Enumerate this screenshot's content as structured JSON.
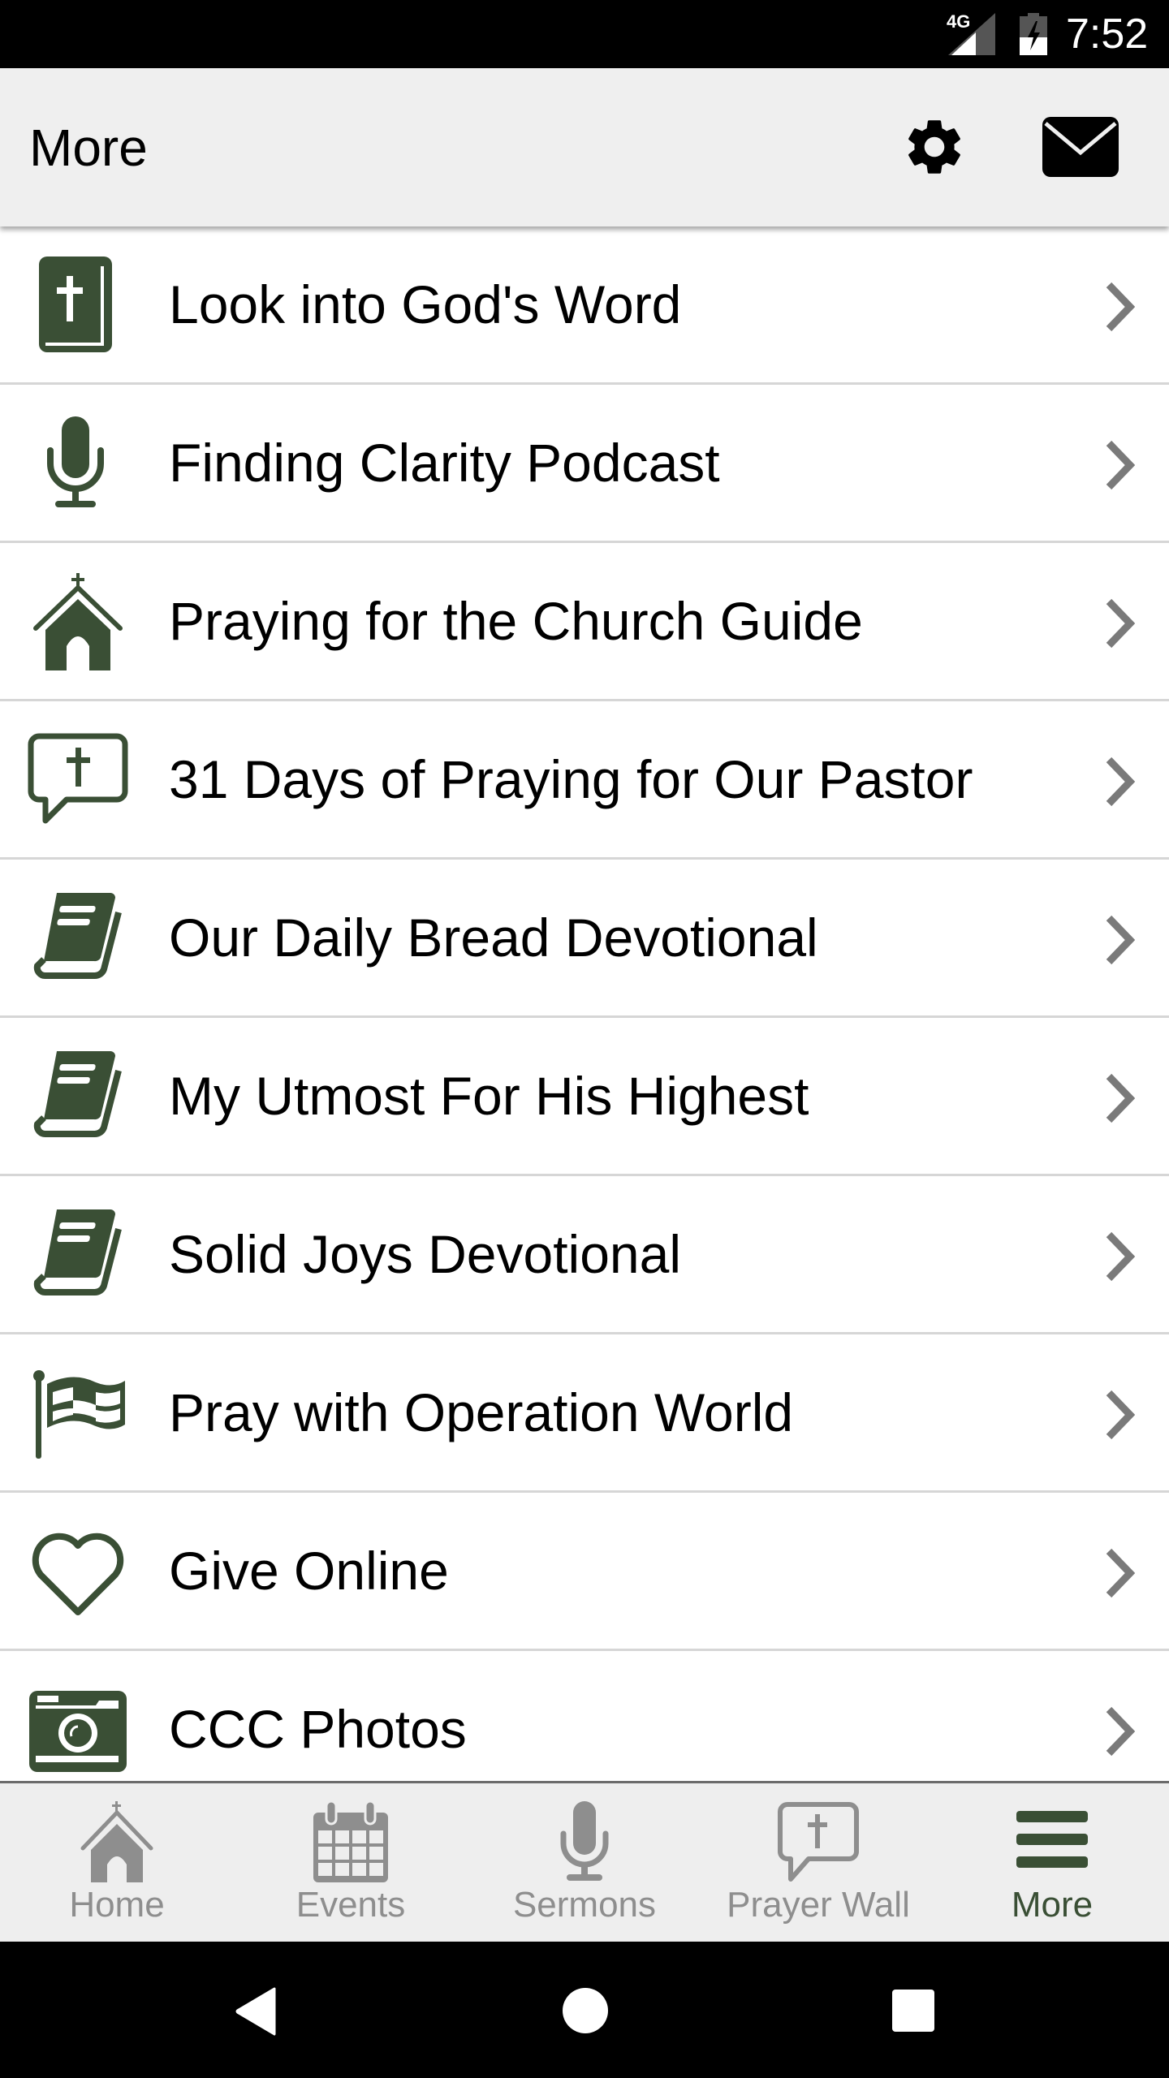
{
  "status_bar": {
    "network": "4G",
    "time": "7:52",
    "icons": [
      "signal-icon",
      "battery-charging-icon"
    ]
  },
  "app_bar": {
    "title": "More",
    "actions": [
      {
        "name": "settings",
        "icon": "gear-icon"
      },
      {
        "name": "messages",
        "icon": "mail-icon"
      }
    ]
  },
  "colors": {
    "accent": "#3a4f35",
    "inactive": "#8e8e8e",
    "chevron": "#7a7a7a",
    "app_bar_bg": "#efefef",
    "divider": "#d6d6d6"
  },
  "list": {
    "items": [
      {
        "label": "Look into God's Word",
        "icon": "bible-icon"
      },
      {
        "label": "Finding Clarity Podcast",
        "icon": "microphone-icon"
      },
      {
        "label": "Praying for the Church Guide",
        "icon": "church-icon"
      },
      {
        "label": "31 Days of Praying for Our Pastor",
        "icon": "prayer-bubble-icon"
      },
      {
        "label": "Our Daily Bread Devotional",
        "icon": "book-icon"
      },
      {
        "label": "My Utmost For His Highest",
        "icon": "book-icon"
      },
      {
        "label": "Solid Joys Devotional",
        "icon": "book-icon"
      },
      {
        "label": "Pray with Operation World",
        "icon": "flag-icon"
      },
      {
        "label": "Give Online",
        "icon": "heart-icon"
      },
      {
        "label": "CCC Photos",
        "icon": "camera-icon"
      }
    ]
  },
  "tab_bar": {
    "active": "More",
    "tabs": [
      {
        "label": "Home",
        "icon": "church-icon"
      },
      {
        "label": "Events",
        "icon": "calendar-icon"
      },
      {
        "label": "Sermons",
        "icon": "microphone-icon"
      },
      {
        "label": "Prayer Wall",
        "icon": "prayer-bubble-icon"
      },
      {
        "label": "More",
        "icon": "menu-icon"
      }
    ]
  },
  "system_nav": {
    "buttons": [
      "back",
      "home",
      "recents"
    ]
  }
}
